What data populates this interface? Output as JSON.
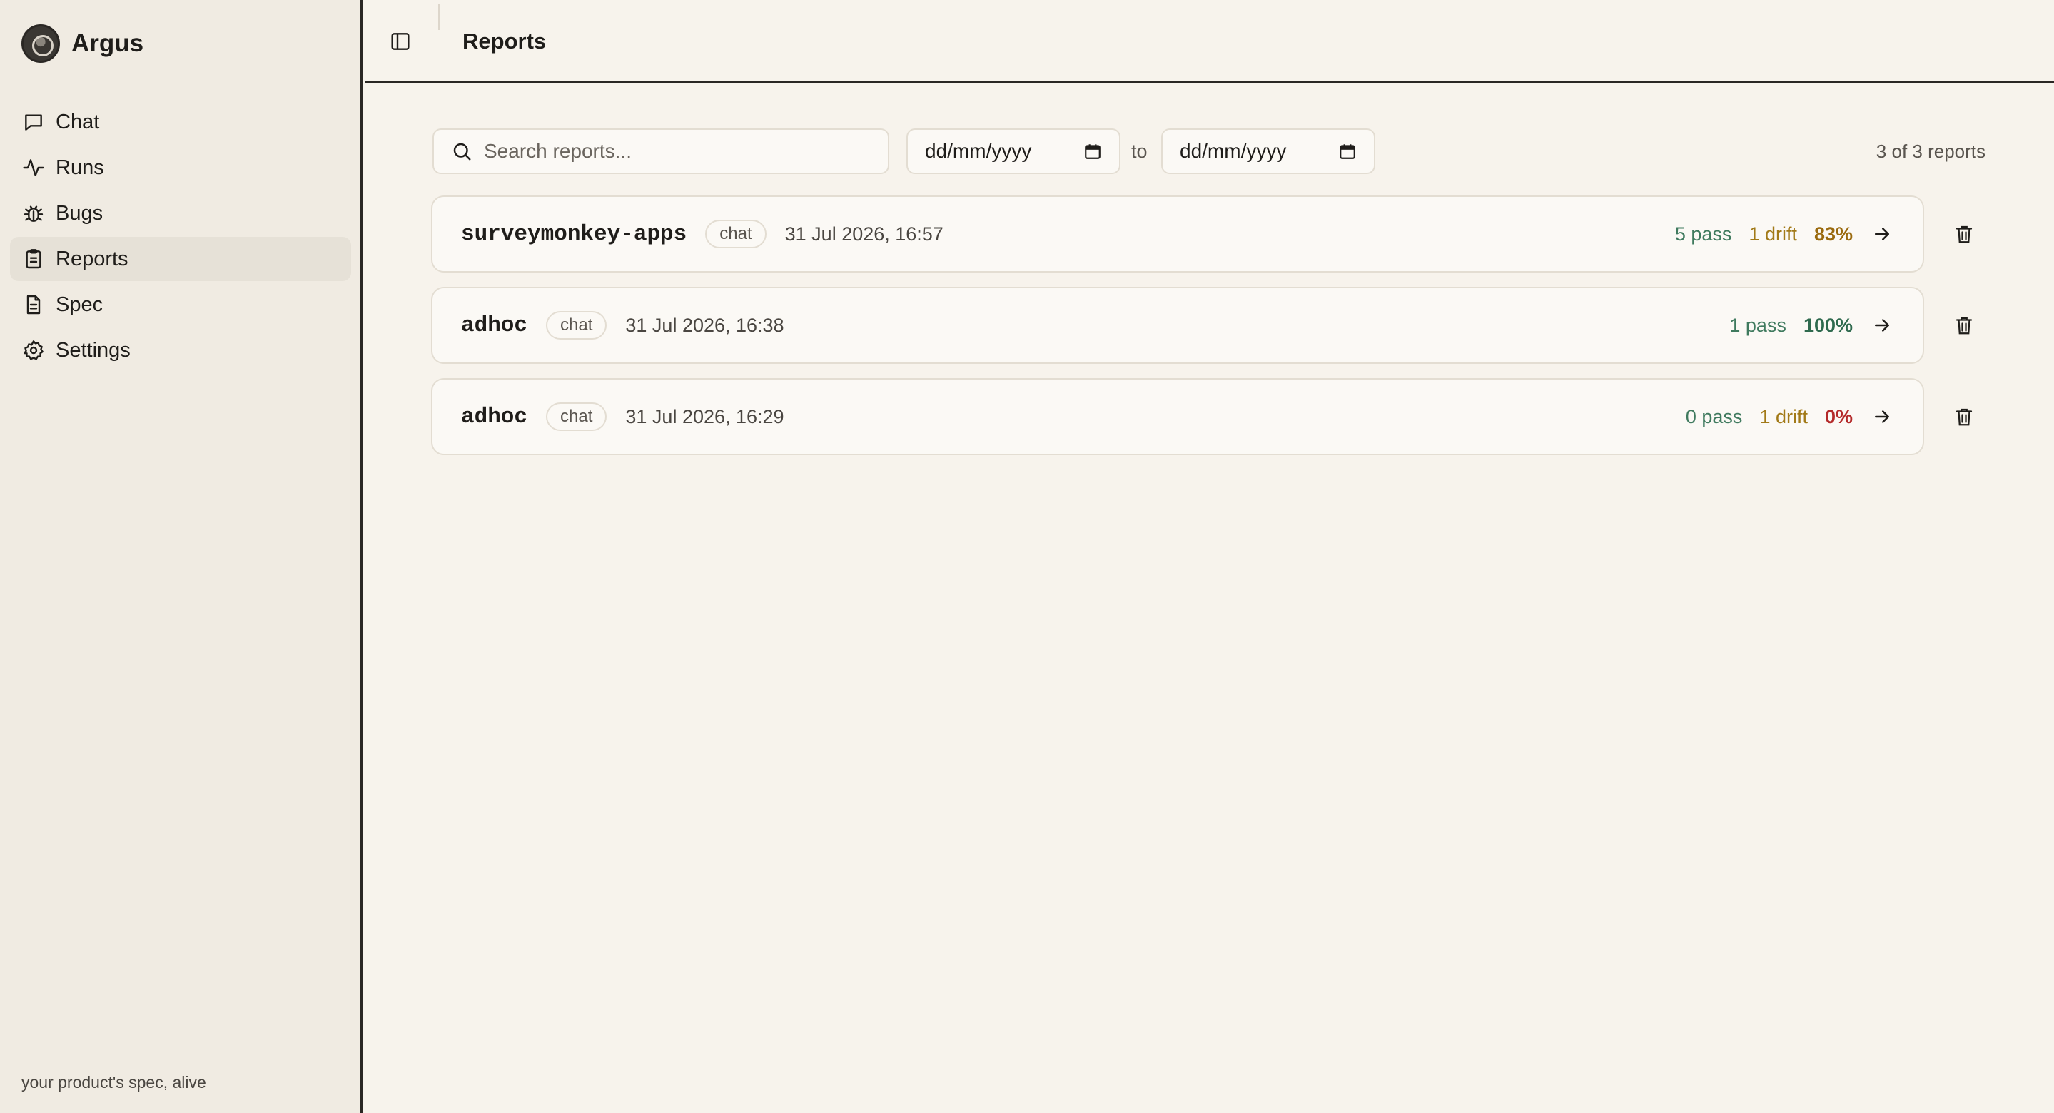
{
  "app": {
    "name": "Argus",
    "tagline": "your product's spec, alive"
  },
  "sidebar": {
    "items": [
      {
        "label": "Chat",
        "icon": "chat-icon",
        "active": false
      },
      {
        "label": "Runs",
        "icon": "activity-icon",
        "active": false
      },
      {
        "label": "Bugs",
        "icon": "bug-icon",
        "active": false
      },
      {
        "label": "Reports",
        "icon": "clipboard-icon",
        "active": true
      },
      {
        "label": "Spec",
        "icon": "document-icon",
        "active": false
      },
      {
        "label": "Settings",
        "icon": "gear-icon",
        "active": false
      }
    ]
  },
  "header": {
    "title": "Reports"
  },
  "filters": {
    "search_placeholder": "Search reports...",
    "date_from_placeholder": "dd/mm/yyyy",
    "date_to_placeholder": "dd/mm/yyyy",
    "to_label": "to",
    "count": "3 of 3 reports"
  },
  "reports": [
    {
      "name": "surveymonkey-apps",
      "tag": "chat",
      "date": "31 Jul 2026, 16:57",
      "pass": "5 pass",
      "drift": "1 drift",
      "percent": "83%",
      "percent_status": "warn"
    },
    {
      "name": "adhoc",
      "tag": "chat",
      "date": "31 Jul 2026, 16:38",
      "pass": "1 pass",
      "drift": "",
      "percent": "100%",
      "percent_status": "good"
    },
    {
      "name": "adhoc",
      "tag": "chat",
      "date": "31 Jul 2026, 16:29",
      "pass": "0 pass",
      "drift": "1 drift",
      "percent": "0%",
      "percent_status": "bad"
    }
  ],
  "colors": {
    "background": "#f7f3ec",
    "sidebar": "#f0ebe2",
    "pass": "#3f7a5e",
    "drift": "#a27a18",
    "percent_good": "#2f6a4e",
    "percent_warn": "#9a6a0e",
    "percent_bad": "#b42a2a"
  }
}
